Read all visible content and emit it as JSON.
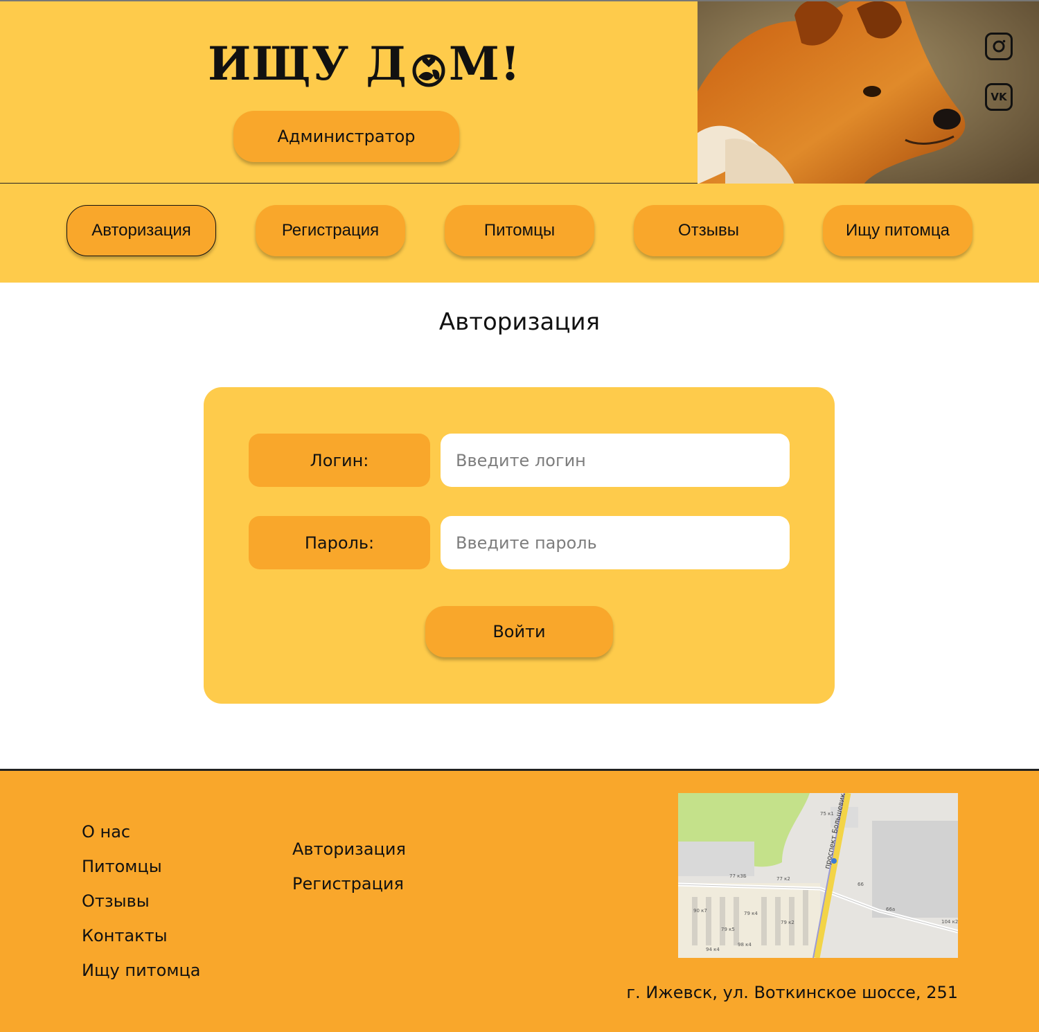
{
  "header": {
    "logo_part1": "ИЩУ Д",
    "logo_part2": "М!",
    "admin_label": "Администратор",
    "social": [
      "instagram-icon",
      "vk-icon"
    ],
    "vk_text": "VK"
  },
  "nav": {
    "items": [
      {
        "label": "Авторизация",
        "active": true
      },
      {
        "label": "Регистрация",
        "active": false
      },
      {
        "label": "Питомцы",
        "active": false
      },
      {
        "label": "Отзывы",
        "active": false
      },
      {
        "label": "Ищу питомца",
        "active": false
      }
    ]
  },
  "main": {
    "title": "Авторизация",
    "login_label": "Логин:",
    "login_placeholder": "Введите логин",
    "password_label": "Пароль:",
    "password_placeholder": "Введите пароль",
    "submit_label": "Войти"
  },
  "footer": {
    "col1": [
      "О нас",
      "Питомцы",
      "Отзывы",
      "Контакты",
      "Ищу питомца"
    ],
    "col2": [
      "Авторизация",
      "Регистрация"
    ],
    "map_street": "проспект Большевиков",
    "map_labels": [
      "75 к1",
      "77 к3Б",
      "77 к2",
      "66",
      "66а",
      "90 к7",
      "79 к4",
      "79 к2",
      "104 к2",
      "79 к5",
      "98 к4",
      "94 к4"
    ],
    "address": "г. Ижевск, ул. Воткинское шоссе, 251"
  },
  "colors": {
    "light_yellow": "#fecb4b",
    "orange": "#f9a72b",
    "text": "#111111"
  }
}
